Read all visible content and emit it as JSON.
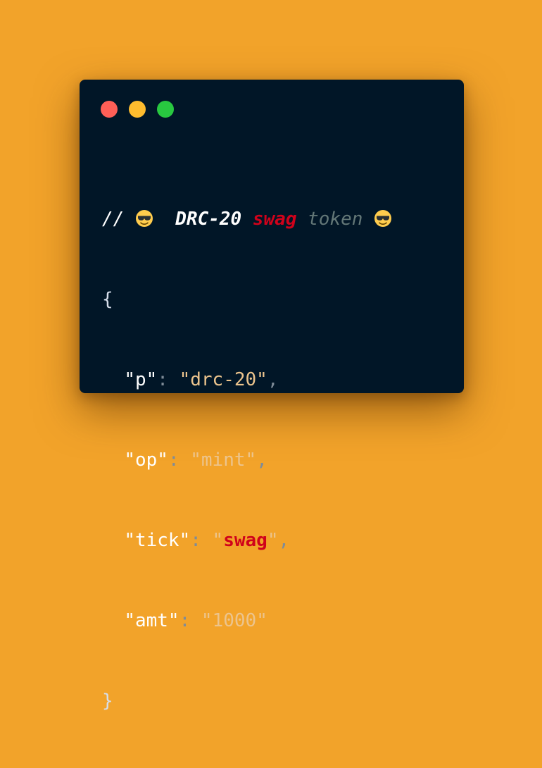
{
  "window": {
    "controls": [
      "close",
      "minimize",
      "maximize"
    ],
    "colors": {
      "background": "#011627",
      "close": "#FF5F57",
      "minimize": "#FEBC2E",
      "maximize": "#28C840",
      "accent": "#D0021B",
      "string": "#ECC48D"
    }
  },
  "code": {
    "comment": {
      "slashes": "//",
      "emoji_icon": "sunglasses-emoji-icon",
      "title": "DRC-20",
      "accent": "swag",
      "muted": "token"
    },
    "open_brace": "{",
    "close_brace": "}",
    "fields": [
      {
        "key": "\"p\"",
        "quote_open": "\"",
        "value": "drc-20",
        "quote_close": "\"",
        "trail": ","
      },
      {
        "key": "\"op\"",
        "quote_open": "\"",
        "value": "mint",
        "quote_close": "\"",
        "trail": ","
      },
      {
        "key": "\"tick\"",
        "quote_open": "\"",
        "value": "swag",
        "quote_close": "\"",
        "trail": ","
      },
      {
        "key": "\"amt\"",
        "quote_open": "\"",
        "value": "1000",
        "quote_close": "\"",
        "trail": ""
      }
    ],
    "colon": ": "
  }
}
